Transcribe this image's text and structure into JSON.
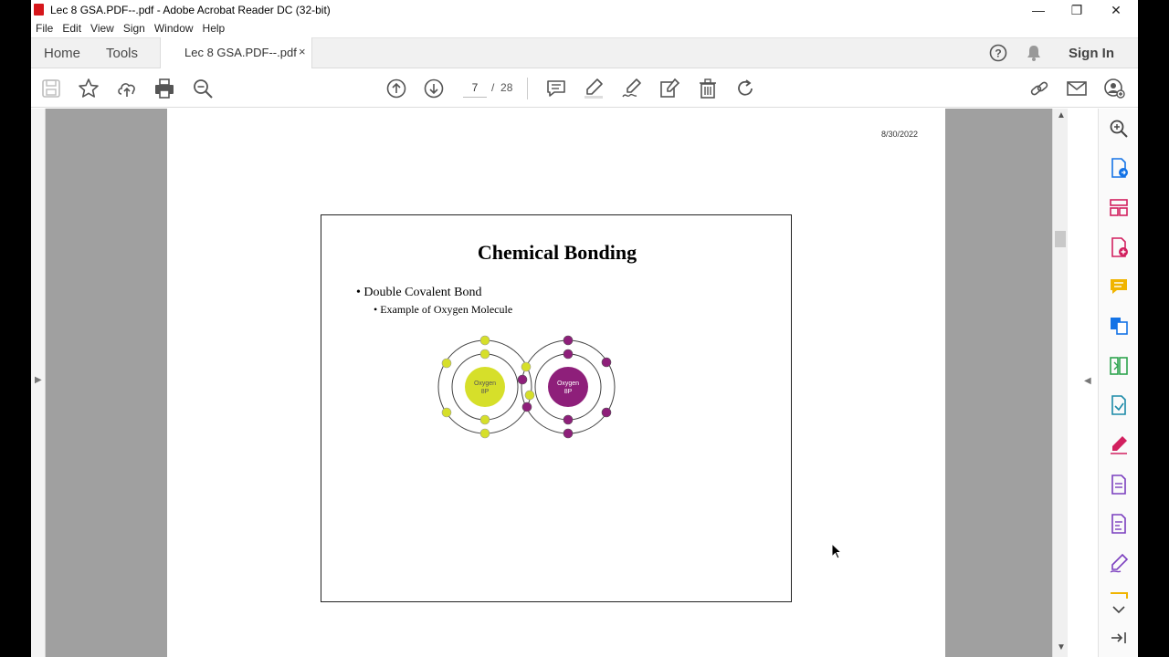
{
  "window": {
    "title": "Lec 8 GSA.PDF--.pdf - Adobe Acrobat Reader DC (32-bit)",
    "minimize": "—",
    "maximize": "❐",
    "close": "✕"
  },
  "menu": [
    "File",
    "Edit",
    "View",
    "Sign",
    "Window",
    "Help"
  ],
  "tabs": {
    "home": "Home",
    "tools": "Tools",
    "document": "Lec 8 GSA.PDF--.pdf",
    "close": "×"
  },
  "header_right": {
    "help": "?",
    "sign_in": "Sign In"
  },
  "toolbar": {
    "current_page": "7",
    "page_separator": "/",
    "total_pages": "28"
  },
  "page": {
    "date": "8/30/2022",
    "slide": {
      "title": "Chemical Bonding",
      "bullet1": "• Double Covalent Bond",
      "bullet2": "• Example of Oxygen Molecule",
      "atom_left": {
        "name": "Oxygen",
        "protons": "8P",
        "color": "#d6df2a"
      },
      "atom_right": {
        "name": "Oxygen",
        "protons": "8P",
        "color": "#8e1f7a"
      }
    }
  },
  "colors": {
    "accent": "#d6161b",
    "tool_blue": "#1473e6",
    "tool_pink": "#d2205f",
    "tool_yellow": "#f0b400",
    "tool_green": "#2da44e",
    "tool_purple": "#7b3fbf"
  },
  "icons": {
    "scroll_up": "▲",
    "scroll_down": "▼",
    "panel_left": "▶",
    "panel_right": "◀"
  }
}
